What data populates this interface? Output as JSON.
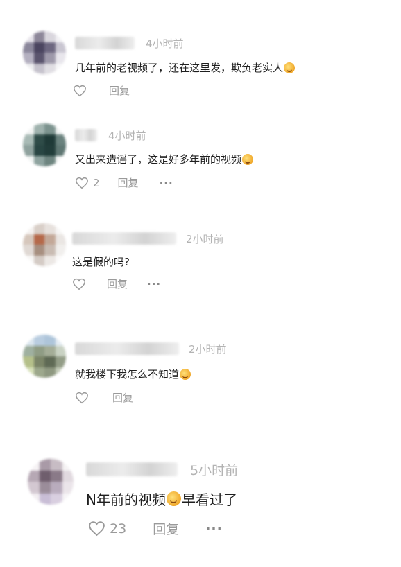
{
  "comments": [
    {
      "time": "4小时前",
      "text_before": "几年前的老视频了，还在这里发，欺负老实人",
      "text_after": "",
      "emoji": "grinning-cat-emoji",
      "likes": "",
      "reply": "回复",
      "more": ""
    },
    {
      "time": "4小时前",
      "text_before": "又出来造谣了，这是好多年前的视频",
      "text_after": "",
      "emoji": "grinning-cat-emoji",
      "likes": "2",
      "reply": "回复",
      "more": "···"
    },
    {
      "time": "2小时前",
      "text_before": "这是假的吗?",
      "text_after": "",
      "emoji": "",
      "likes": "",
      "reply": "回复",
      "more": "···"
    },
    {
      "time": "2小时前",
      "text_before": "就我楼下我怎么不知道",
      "text_after": "",
      "emoji": "laughing-emoji",
      "likes": "",
      "reply": "回复",
      "more": ""
    },
    {
      "time": "5小时前",
      "text_before": "N年前的视频",
      "text_after": "早看过了",
      "emoji": "laughing-emoji",
      "likes": "23",
      "reply": "回复",
      "more": "···"
    }
  ],
  "colors": {
    "time": "#b3b3b3",
    "text": "#1f1f1f",
    "action": "#9a9a9a"
  }
}
